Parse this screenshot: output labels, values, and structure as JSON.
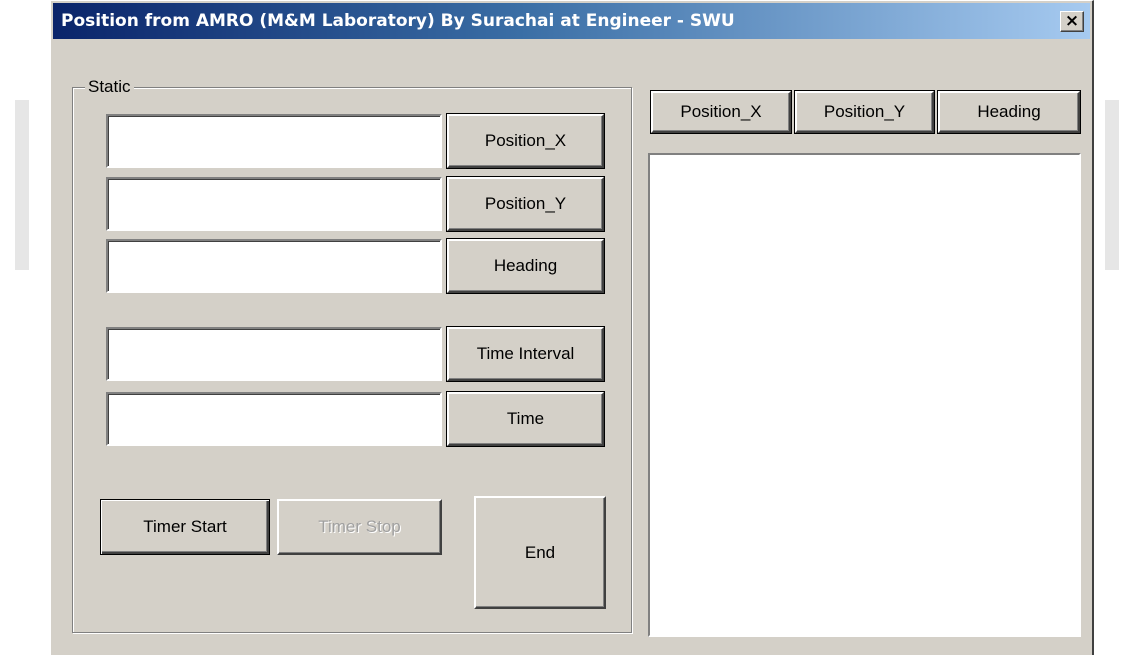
{
  "window": {
    "title": "Position from AMRO (M&M Laboratory) By Surachai  at Engineer - SWU",
    "close_glyph": "×"
  },
  "group": {
    "label": "Static"
  },
  "fields": {
    "position_x": {
      "value": "",
      "button_label": "Position_X"
    },
    "position_y": {
      "value": "",
      "button_label": "Position_Y"
    },
    "heading": {
      "value": "",
      "button_label": "Heading"
    },
    "time_interval": {
      "value": "",
      "button_label": "Time Interval"
    },
    "time": {
      "value": "",
      "button_label": "Time"
    }
  },
  "buttons": {
    "timer_start": "Timer Start",
    "timer_stop": "Timer Stop",
    "end": "End"
  },
  "list_headers": {
    "position_x": "Position_X",
    "position_y": "Position_Y",
    "heading": "Heading"
  },
  "colors": {
    "face": "#d4d0c8",
    "title_start": "#0a246a",
    "title_end": "#a6caf0"
  }
}
